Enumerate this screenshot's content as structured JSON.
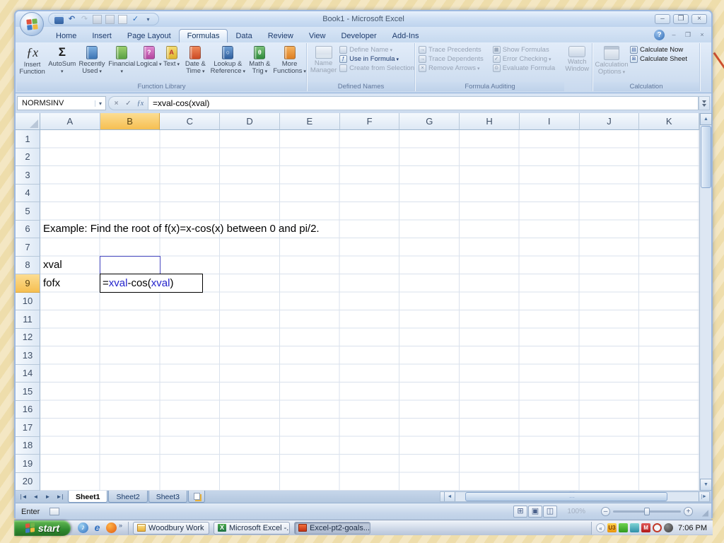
{
  "colors": {
    "formula_ref_blue": "#2323cc",
    "selected_header_orange": "#f6bf51",
    "desktop_background_yellow": "#f0e0b5",
    "desktop_accent_line_red": "#cd4f2e",
    "ribbon_blue_theme": "#dce6f4",
    "taskbar_silver": "#cfd9e8"
  },
  "icons": {
    "qat": [
      "save",
      "undo",
      "redo",
      "print-preview",
      "open",
      "new",
      "spelling",
      "customize-dropdown"
    ],
    "formula_bar": [
      "cancel-x",
      "enter-check",
      "insert-function-fx"
    ],
    "tray": [
      "hide-chevron",
      "u3",
      "wireless-green",
      "teal-app",
      "mcafee-m",
      "quicktime-ring",
      "dark-clock"
    ]
  },
  "titlebar": {
    "title": "Book1 - Microsoft Excel"
  },
  "tabs": {
    "items": [
      {
        "label": "Home"
      },
      {
        "label": "Insert"
      },
      {
        "label": "Page Layout"
      },
      {
        "label": "Formulas"
      },
      {
        "label": "Data"
      },
      {
        "label": "Review"
      },
      {
        "label": "View"
      },
      {
        "label": "Developer"
      },
      {
        "label": "Add-Ins"
      }
    ],
    "active": "Formulas"
  },
  "ribbon": {
    "groups": [
      {
        "label": "Function Library",
        "items": [
          {
            "label": "Insert Function"
          },
          {
            "label": "AutoSum"
          },
          {
            "label": "Recently Used"
          },
          {
            "label": "Financial"
          },
          {
            "label": "Logical"
          },
          {
            "label": "Text"
          },
          {
            "label": "Date & Time"
          },
          {
            "label": "Lookup & Reference"
          },
          {
            "label": "Math & Trig"
          },
          {
            "label": "More Functions"
          }
        ]
      },
      {
        "label": "Defined Names",
        "items": [
          {
            "label": "Name Manager"
          },
          {
            "label": "Define Name"
          },
          {
            "label": "Use in Formula"
          },
          {
            "label": "Create from Selection"
          }
        ]
      },
      {
        "label": "Formula Auditing",
        "items": [
          {
            "label": "Trace Precedents"
          },
          {
            "label": "Trace Dependents"
          },
          {
            "label": "Remove Arrows"
          },
          {
            "label": "Show Formulas"
          },
          {
            "label": "Error Checking"
          },
          {
            "label": "Evaluate Formula"
          },
          {
            "label": "Watch Window"
          }
        ]
      },
      {
        "label": "Calculation",
        "items": [
          {
            "label": "Calculation Options"
          },
          {
            "label": "Calculate Now"
          },
          {
            "label": "Calculate Sheet"
          }
        ]
      }
    ]
  },
  "fbar": {
    "name_box": "NORMSINV",
    "formula": "=xval-cos(xval)"
  },
  "sheet": {
    "columns": [
      "A",
      "B",
      "C",
      "D",
      "E",
      "F",
      "G",
      "H",
      "I",
      "J",
      "K"
    ],
    "rows": [
      "1",
      "2",
      "3",
      "4",
      "5",
      "6",
      "7",
      "8",
      "9",
      "10",
      "11",
      "12",
      "13",
      "14",
      "15",
      "16",
      "17",
      "18",
      "19",
      "20"
    ],
    "selected_column": "B",
    "selected_row": "9",
    "cells": {
      "a6": "Example: Find the root of f(x)=x-cos(x) between 0 and pi/2.",
      "a8": "xval",
      "a9": "fofx"
    },
    "edit_parts": [
      {
        "t": "="
      },
      {
        "t": "xval"
      },
      {
        "t": "-cos("
      },
      {
        "t": "xval"
      },
      {
        "t": ")"
      }
    ]
  },
  "sheet_tabs": [
    {
      "label": "Sheet1",
      "active": true
    },
    {
      "label": "Sheet2",
      "active": false
    },
    {
      "label": "Sheet3",
      "active": false
    }
  ],
  "status": {
    "mode": "Enter",
    "zoom_level": "100%"
  },
  "taskbar": {
    "start_label": "start",
    "tasks": [
      {
        "label": "Woodbury Work"
      },
      {
        "label": "Microsoft Excel -..."
      },
      {
        "label": "Excel-pt2-goals...",
        "active": true
      }
    ],
    "clock": "7:06 PM"
  }
}
